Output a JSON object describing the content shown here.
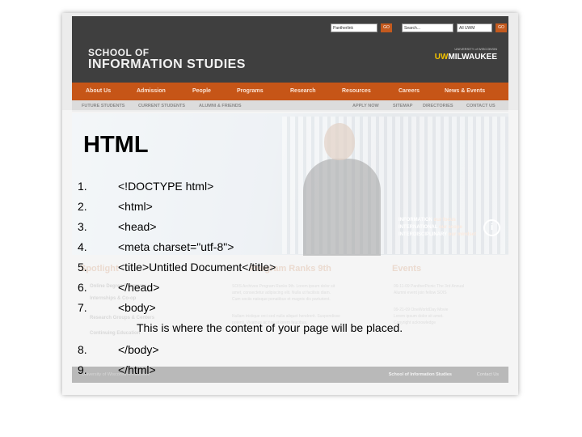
{
  "site": {
    "logo_line1": "SCHOOL OF",
    "logo_line2": "INFORMATION STUDIES",
    "uwm_small": "UNIVERSITY of WISCONSIN",
    "uwm_prefix": "UW",
    "uwm_name": "MILWAUKEE",
    "controls": {
      "pantherlink": "Pantherlink",
      "go1": "GO",
      "search_placeholder": "Search...",
      "scope": "All UWM",
      "go2": "GO"
    },
    "nav": [
      "About Us",
      "Admission",
      "People",
      "Programs",
      "Research",
      "Resources",
      "Careers",
      "News & Events"
    ],
    "subnav_left": [
      "FUTURE STUDENTS",
      "CURRENT STUDENTS",
      "ALUMNI & FRIENDS"
    ],
    "subnav_right": [
      "APPLY NOW",
      "SITEMAP",
      "DIRECTORIES",
      "CONTACT US"
    ],
    "tagline": {
      "line1a": "INFORMATION",
      "line1b": " our focus",
      "line2a": "INTERNATIONAL",
      "line2b": " our scope",
      "line3a": "INTERDISCIPLINARY",
      "line3b": " our mindset"
    },
    "spotlight_title": "Spotlight",
    "news_title": "Program Ranks 9th",
    "events_title": "Events",
    "spotlight_items": [
      "Online Degree Programs",
      "Internships & Co-op",
      "Research Groups & Centers",
      "Continuing Education"
    ],
    "news_lines": [
      "SOIS Archives Program Ranks 9th. Lorem ipsum dolor sit",
      "amet, consectetur adipiscing elit. Nulla ut facilisis diam.",
      "Cum sociis natoque penatibus et magnis dis parturient.",
      "Nullam tristique orci sed nulla aliquet hendrerit. Suspendisse",
      "potenti. Vivamus ac nisi ut lorem faucibus."
    ],
    "event_lines": [
      "09-11-09  PantherPicnic  The 3rd Annual",
      "Alumni event join fellow SOIS",
      "09-21-09  OneWorldDay Movie",
      "Lorem ipsum dolor sit amet.",
      "Copyright acknowledge"
    ],
    "footer_left": "University of Wisconsin-Milwaukee",
    "footer_right": "School of Information Studies",
    "footer_contact": "Contact Us"
  },
  "slide": {
    "title": "HTML",
    "lines": [
      {
        "num": "1.",
        "code": "<!DOCTYPE html>"
      },
      {
        "num": "2.",
        "code": "<html>"
      },
      {
        "num": "3.",
        "code": "<head>"
      },
      {
        "num": "4.",
        "code": "<meta charset=\"utf-8\">"
      },
      {
        "num": "5.",
        "code": "<title>Untitled Document</title>"
      },
      {
        "num": "6.",
        "code": "</head>"
      },
      {
        "num": "7.",
        "code": "<body>"
      },
      {
        "num": "8.",
        "code": "</body>"
      },
      {
        "num": "9.",
        "code": "</html>"
      }
    ],
    "content_text": "This is where the content of your page will be placed."
  }
}
